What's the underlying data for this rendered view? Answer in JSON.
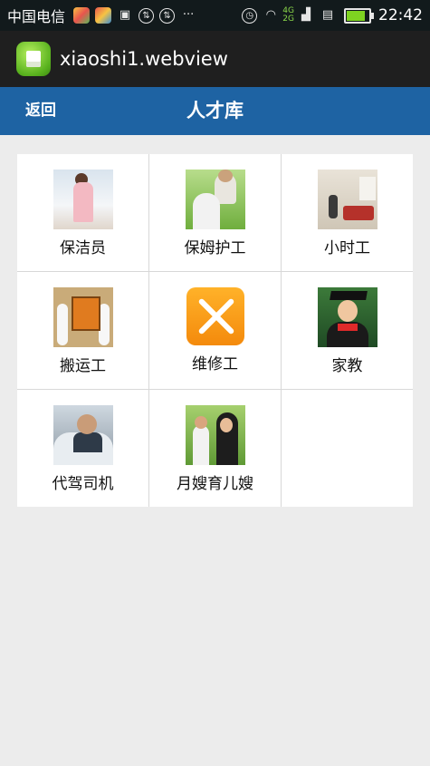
{
  "status_bar": {
    "carrier": "中国电信",
    "network_4g": "4G",
    "network_2g": "2G",
    "time": "22:42",
    "icons": [
      "app-notification-icon",
      "app-notification-icon",
      "sim-icon",
      "sync-icon",
      "sync-icon",
      "more-icon",
      "alarm-icon",
      "wifi-icon",
      "signal-icon",
      "sim-card-icon",
      "battery-icon"
    ],
    "overflow": "···"
  },
  "app_bar": {
    "title": "xiaoshi1.webview",
    "icon": "android-app-icon"
  },
  "nav": {
    "back_label": "返回",
    "title": "人才库"
  },
  "categories": [
    {
      "label": "保洁员",
      "icon": "cleaner-photo"
    },
    {
      "label": "保姆护工",
      "icon": "nanny-photo"
    },
    {
      "label": "小时工",
      "icon": "hourly-worker-photo"
    },
    {
      "label": "搬运工",
      "icon": "mover-photo"
    },
    {
      "label": "维修工",
      "icon": "repair-tools-icon"
    },
    {
      "label": "家教",
      "icon": "tutor-photo"
    },
    {
      "label": "代驾司机",
      "icon": "driver-photo"
    },
    {
      "label": "月嫂育儿嫂",
      "icon": "maternity-nanny-photo"
    }
  ],
  "colors": {
    "status_bar_bg": "#121a1c",
    "app_bar_bg": "#1f1f1f",
    "nav_bg": "#1e63a3",
    "page_bg": "#ececec",
    "grid_line": "#d8d8d8"
  }
}
